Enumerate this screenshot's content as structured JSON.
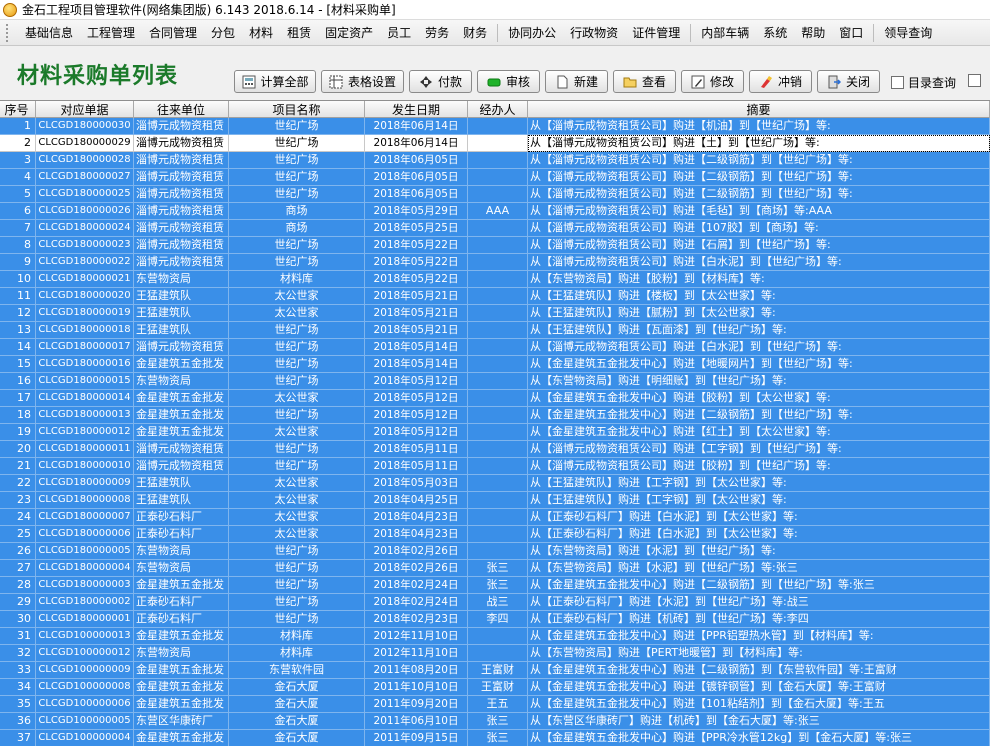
{
  "window": {
    "title": "金石工程项目管理软件(网络集团版) 6.143  2018.6.14 - [材料采购单]"
  },
  "menu": [
    "基础信息",
    "工程管理",
    "合同管理",
    "分包",
    "材料",
    "租赁",
    "固定资产",
    "员工",
    "劳务",
    "财务",
    "协同办公",
    "行政物资",
    "证件管理",
    "内部车辆",
    "系统",
    "帮助",
    "窗口",
    "领导查询"
  ],
  "page_title": "材料采购单列表",
  "toolbar": {
    "calc_all": "计算全部",
    "table_settings": "表格设置",
    "pay": "付款",
    "audit": "审核",
    "new": "新建",
    "view": "查看",
    "edit": "修改",
    "reverse": "冲销",
    "close": "关闭",
    "dir_query": "目录查询"
  },
  "columns": [
    "序号",
    "对应单据",
    "往来单位",
    "项目名称",
    "发生日期",
    "经办人",
    "摘要"
  ],
  "rows": [
    [
      "1",
      "CLCGD180000030",
      "淄博元成物资租赁",
      "世纪广场",
      "2018年06月14日",
      "",
      "从【淄博元成物资租赁公司】购进【机油】到【世纪广场】等:"
    ],
    [
      "2",
      "CLCGD180000029",
      "淄博元成物资租赁",
      "世纪广场",
      "2018年06月14日",
      "",
      "从【淄博元成物资租赁公司】购进【土】到【世纪广场】等:"
    ],
    [
      "3",
      "CLCGD180000028",
      "淄博元成物资租赁",
      "世纪广场",
      "2018年06月05日",
      "",
      "从【淄博元成物资租赁公司】购进【二级钢筋】到【世纪广场】等:"
    ],
    [
      "4",
      "CLCGD180000027",
      "淄博元成物资租赁",
      "世纪广场",
      "2018年06月05日",
      "",
      "从【淄博元成物资租赁公司】购进【二级钢筋】到【世纪广场】等:"
    ],
    [
      "5",
      "CLCGD180000025",
      "淄博元成物资租赁",
      "世纪广场",
      "2018年06月05日",
      "",
      "从【淄博元成物资租赁公司】购进【二级钢筋】到【世纪广场】等:"
    ],
    [
      "6",
      "CLCGD180000026",
      "淄博元成物资租赁",
      "商场",
      "2018年05月29日",
      "AAA",
      "从【淄博元成物资租赁公司】购进【毛毡】到【商场】等:AAA"
    ],
    [
      "7",
      "CLCGD180000024",
      "淄博元成物资租赁",
      "商场",
      "2018年05月25日",
      "",
      "从【淄博元成物资租赁公司】购进【107胶】到【商场】等:"
    ],
    [
      "8",
      "CLCGD180000023",
      "淄博元成物资租赁",
      "世纪广场",
      "2018年05月22日",
      "",
      "从【淄博元成物资租赁公司】购进【石屑】到【世纪广场】等:"
    ],
    [
      "9",
      "CLCGD180000022",
      "淄博元成物资租赁",
      "世纪广场",
      "2018年05月22日",
      "",
      "从【淄博元成物资租赁公司】购进【白水泥】到【世纪广场】等:"
    ],
    [
      "10",
      "CLCGD180000021",
      "东营物资局",
      "材料库",
      "2018年05月22日",
      "",
      "从【东营物资局】购进【胶粉】到【材料库】等:"
    ],
    [
      "11",
      "CLCGD180000020",
      "王猛建筑队",
      "太公世家",
      "2018年05月21日",
      "",
      "从【王猛建筑队】购进【楼板】到【太公世家】等:"
    ],
    [
      "12",
      "CLCGD180000019",
      "王猛建筑队",
      "太公世家",
      "2018年05月21日",
      "",
      "从【王猛建筑队】购进【腻粉】到【太公世家】等:"
    ],
    [
      "13",
      "CLCGD180000018",
      "王猛建筑队",
      "世纪广场",
      "2018年05月21日",
      "",
      "从【王猛建筑队】购进【瓦面漆】到【世纪广场】等:"
    ],
    [
      "14",
      "CLCGD180000017",
      "淄博元成物资租赁",
      "世纪广场",
      "2018年05月14日",
      "",
      "从【淄博元成物资租赁公司】购进【白水泥】到【世纪广场】等:"
    ],
    [
      "15",
      "CLCGD180000016",
      "金星建筑五金批发",
      "世纪广场",
      "2018年05月14日",
      "",
      "从【金星建筑五金批发中心】购进【地暖网片】到【世纪广场】等:"
    ],
    [
      "16",
      "CLCGD180000015",
      "东营物资局",
      "世纪广场",
      "2018年05月12日",
      "",
      "从【东营物资局】购进【明细账】到【世纪广场】等:"
    ],
    [
      "17",
      "CLCGD180000014",
      "金星建筑五金批发",
      "太公世家",
      "2018年05月12日",
      "",
      "从【金星建筑五金批发中心】购进【胶粉】到【太公世家】等:"
    ],
    [
      "18",
      "CLCGD180000013",
      "金星建筑五金批发",
      "世纪广场",
      "2018年05月12日",
      "",
      "从【金星建筑五金批发中心】购进【二级钢筋】到【世纪广场】等:"
    ],
    [
      "19",
      "CLCGD180000012",
      "金星建筑五金批发",
      "太公世家",
      "2018年05月12日",
      "",
      "从【金星建筑五金批发中心】购进【红土】到【太公世家】等:"
    ],
    [
      "20",
      "CLCGD180000011",
      "淄博元成物资租赁",
      "世纪广场",
      "2018年05月11日",
      "",
      "从【淄博元成物资租赁公司】购进【工字钢】到【世纪广场】等:"
    ],
    [
      "21",
      "CLCGD180000010",
      "淄博元成物资租赁",
      "世纪广场",
      "2018年05月11日",
      "",
      "从【淄博元成物资租赁公司】购进【胶粉】到【世纪广场】等:"
    ],
    [
      "22",
      "CLCGD180000009",
      "王猛建筑队",
      "太公世家",
      "2018年05月03日",
      "",
      "从【王猛建筑队】购进【工字钢】到【太公世家】等:"
    ],
    [
      "23",
      "CLCGD180000008",
      "王猛建筑队",
      "太公世家",
      "2018年04月25日",
      "",
      "从【王猛建筑队】购进【工字钢】到【太公世家】等:"
    ],
    [
      "24",
      "CLCGD180000007",
      "正泰砂石料厂",
      "太公世家",
      "2018年04月23日",
      "",
      "从【正泰砂石料厂】购进【白水泥】到【太公世家】等:"
    ],
    [
      "25",
      "CLCGD180000006",
      "正泰砂石料厂",
      "太公世家",
      "2018年04月23日",
      "",
      "从【正泰砂石料厂】购进【白水泥】到【太公世家】等:"
    ],
    [
      "26",
      "CLCGD180000005",
      "东营物资局",
      "世纪广场",
      "2018年02月26日",
      "",
      "从【东营物资局】购进【水泥】到【世纪广场】等:"
    ],
    [
      "27",
      "CLCGD180000004",
      "东营物资局",
      "世纪广场",
      "2018年02月26日",
      "张三",
      "从【东营物资局】购进【水泥】到【世纪广场】等:张三"
    ],
    [
      "28",
      "CLCGD180000003",
      "金星建筑五金批发",
      "世纪广场",
      "2018年02月24日",
      "张三",
      "从【金星建筑五金批发中心】购进【二级钢筋】到【世纪广场】等:张三"
    ],
    [
      "29",
      "CLCGD180000002",
      "正泰砂石料厂",
      "世纪广场",
      "2018年02月24日",
      "战三",
      "从【正泰砂石料厂】购进【水泥】到【世纪广场】等:战三"
    ],
    [
      "30",
      "CLCGD180000001",
      "正泰砂石料厂",
      "世纪广场",
      "2018年02月23日",
      "李四",
      "从【正泰砂石料厂】购进【机砖】到【世纪广场】等:李四"
    ],
    [
      "31",
      "CLCGD100000013",
      "金星建筑五金批发",
      "材料库",
      "2012年11月10日",
      "",
      "从【金星建筑五金批发中心】购进【PPR铝塑热水管】到【材料库】等:"
    ],
    [
      "32",
      "CLCGD100000012",
      "东营物资局",
      "材料库",
      "2012年11月10日",
      "",
      "从【东营物资局】购进【PERT地暖管】到【材料库】等:"
    ],
    [
      "33",
      "CLCGD100000009",
      "金星建筑五金批发",
      "东营软件园",
      "2011年08月20日",
      "王富财",
      "从【金星建筑五金批发中心】购进【二级钢筋】到【东营软件园】等:王富财"
    ],
    [
      "34",
      "CLCGD100000008",
      "金星建筑五金批发",
      "金石大厦",
      "2011年10月10日",
      "王富财",
      "从【金星建筑五金批发中心】购进【镀锌钢管】到【金石大厦】等:王富财"
    ],
    [
      "35",
      "CLCGD100000006",
      "金星建筑五金批发",
      "金石大厦",
      "2011年09月20日",
      "王五",
      "从【金星建筑五金批发中心】购进【101粘结剂】到【金石大厦】等:王五"
    ],
    [
      "36",
      "CLCGD100000005",
      "东营区华康砖厂",
      "金石大厦",
      "2011年06月10日",
      "张三",
      "从【东营区华康砖厂】购进【机砖】到【金石大厦】等:张三"
    ],
    [
      "37",
      "CLCGD100000004",
      "金星建筑五金批发",
      "金石大厦",
      "2011年09月15日",
      "张三",
      "从【金星建筑五金批发中心】购进【PPR冷水管12kg】到【金石大厦】等:张三"
    ]
  ],
  "active_row": 2,
  "colors": {
    "selected_row": "#3a8fe8",
    "title_green": "#1b7a2a"
  }
}
